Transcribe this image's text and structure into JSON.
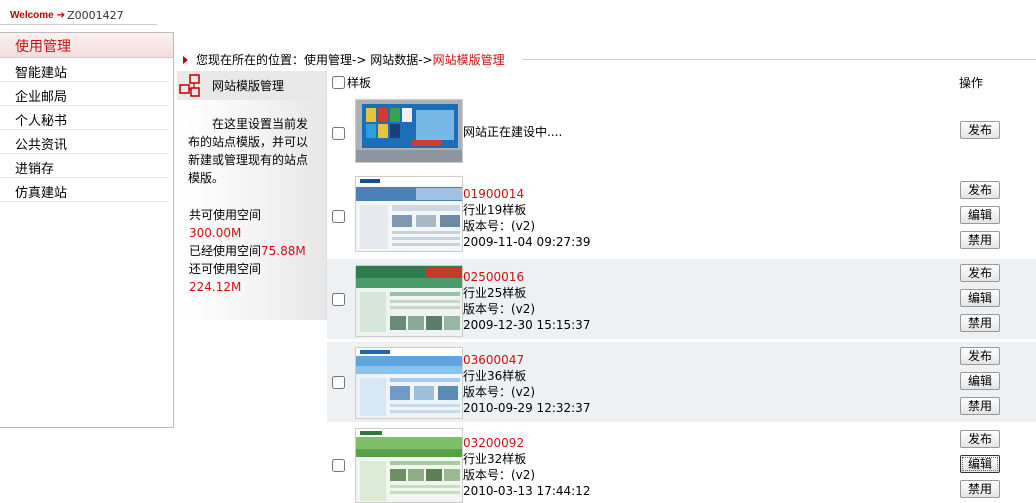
{
  "welcome": {
    "label": "Welcome",
    "user_id": "Z0001427"
  },
  "sidebar": {
    "header": "使用管理",
    "items": [
      {
        "label": "智能建站"
      },
      {
        "label": "企业邮局"
      },
      {
        "label": "个人秘书"
      },
      {
        "label": "公共资讯"
      },
      {
        "label": "进销存"
      },
      {
        "label": "仿真建站"
      }
    ]
  },
  "breadcrumb": {
    "prefix": "您现在所在的位置：使用管理 ",
    "sep1": "-> 网站数据 ",
    "sep2": "-> ",
    "current": "网站模版管理"
  },
  "info": {
    "title": "网站模版管理",
    "description": "在这里设置当前发布的站点模版，并可以新建或管理现有的站点模版。",
    "total_label": "共可使用空间",
    "total_value": "300.00M",
    "used_label": "已经使用空间",
    "used_value": "75.88M",
    "remain_label": "还可使用空间",
    "remain_value": "224.12M"
  },
  "table": {
    "col_template": "样板",
    "col_action": "操作",
    "rows": [
      {
        "status": "网站正在建设中....",
        "publish": "发布",
        "thumb_color": "#1a78c0"
      },
      {
        "code": "01900014",
        "name": "行业19样板",
        "version": "版本号：(v2)",
        "date": "2009-11-04 09:27:39",
        "publish": "发布",
        "edit": "编辑",
        "disable": "禁用"
      },
      {
        "code": "02500016",
        "name": "行业25样板",
        "version": "版本号：(v2)",
        "date": "2009-12-30 15:15:37",
        "publish": "发布",
        "edit": "编辑",
        "disable": "禁用"
      },
      {
        "code": "03600047",
        "name": "行业36样板",
        "version": "版本号：(v2)",
        "date": "2010-09-29 12:32:37",
        "publish": "发布",
        "edit": "编辑",
        "disable": "禁用"
      },
      {
        "code": "03200092",
        "name": "行业32样板",
        "version": "版本号：(v2)",
        "date": "2010-03-13 17:44:12",
        "publish": "发布",
        "edit": "编辑",
        "disable": "禁用"
      }
    ]
  }
}
